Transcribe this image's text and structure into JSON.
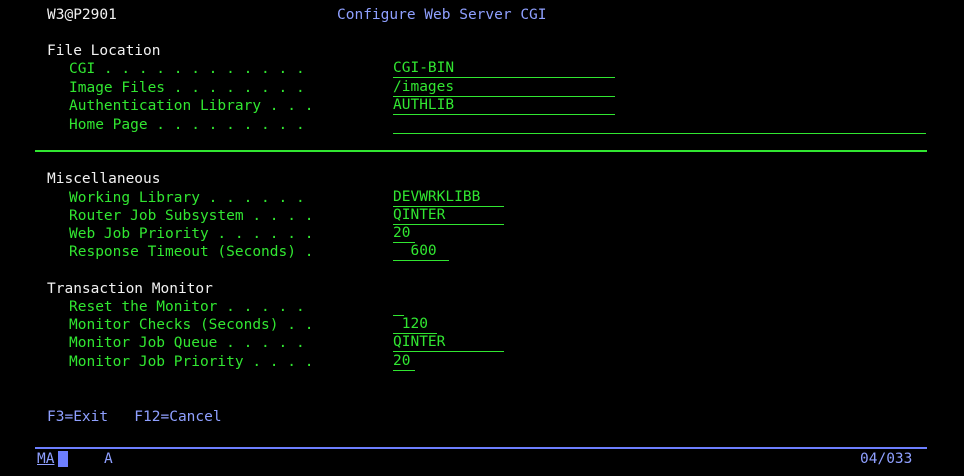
{
  "header": {
    "program_id": "W3@P2901",
    "title": "Configure Web Server CGI"
  },
  "file_location": {
    "heading": "File Location",
    "cgi": {
      "label": "CGI . . . . . . . . . . . .",
      "value": "CGI-BIN"
    },
    "image_files": {
      "label": "Image Files . . . . . . . .",
      "value": "/images"
    },
    "auth_library": {
      "label": "Authentication Library . . .",
      "value": "AUTHLIB"
    },
    "home_page": {
      "label": "Home Page . . . . . . . . .",
      "value": ""
    }
  },
  "miscellaneous": {
    "heading": "Miscellaneous",
    "working_library": {
      "label": "Working Library . . . . . .",
      "value": "DEVWRKLIBB"
    },
    "router_job_subsystem": {
      "label": "Router Job Subsystem . . . .",
      "value": "QINTER"
    },
    "web_job_priority": {
      "label": "Web Job Priority . . . . . .",
      "value": "20"
    },
    "response_timeout": {
      "label": "Response Timeout (Seconds) .",
      "value": "  600"
    }
  },
  "transaction_monitor": {
    "heading": "Transaction Monitor",
    "reset_monitor": {
      "label": "Reset the Monitor . . . . .",
      "value": ""
    },
    "monitor_checks": {
      "label": "Monitor Checks (Seconds) . .",
      "value": " 120"
    },
    "monitor_job_queue": {
      "label": "Monitor Job Queue . . . . .",
      "value": "QINTER"
    },
    "monitor_job_priority": {
      "label": "Monitor Job Priority . . . .",
      "value": "20"
    }
  },
  "function_keys": "F3=Exit   F12=Cancel",
  "status_bar": {
    "mode": "MA",
    "indicator": "A",
    "cursor_position": "04/033"
  },
  "colors": {
    "background": "#000000",
    "field": "#31e631",
    "text": "#f2f2f2",
    "status": "#8fa0ff"
  }
}
